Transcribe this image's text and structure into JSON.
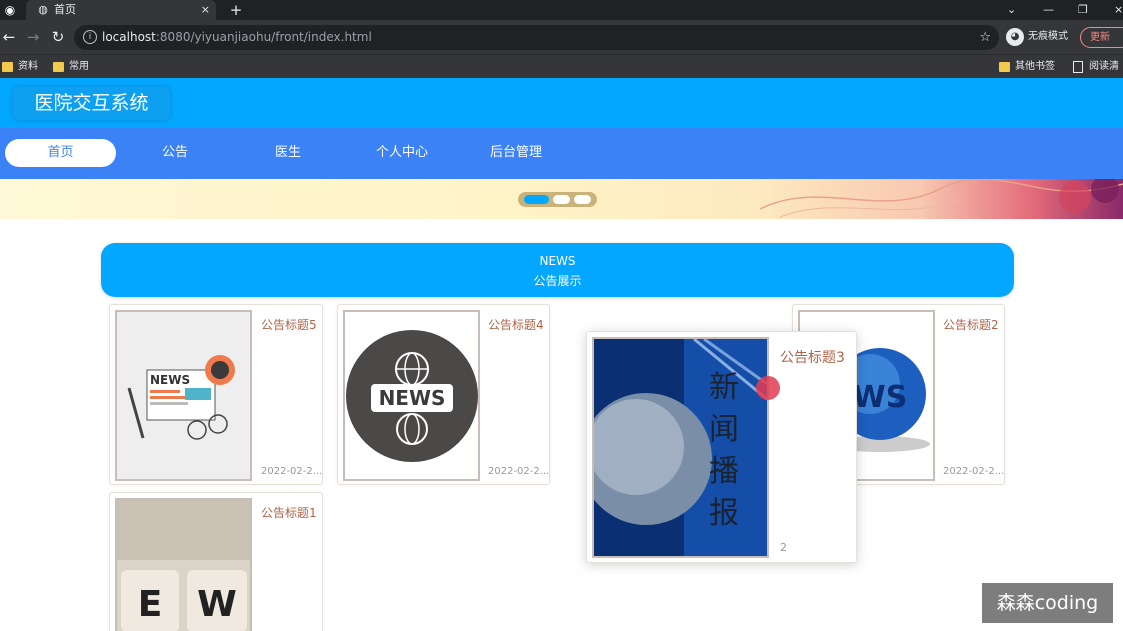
{
  "browser": {
    "tab_title": "首页",
    "tab_close": "×",
    "new_tab": "+",
    "url_host": "localhost",
    "url_rest": ":8080/yiyuanjiaohu/front/index.html",
    "incognito_label": "无痕模式",
    "update_label": "更新",
    "bookmarks": [
      "资料",
      "常用"
    ],
    "bookmarks_right": [
      "其他书签",
      "阅读清单"
    ]
  },
  "site": {
    "logo": "医院交互系统",
    "nav": [
      "首页",
      "公告",
      "医生",
      "个人中心",
      "后台管理"
    ],
    "active_nav": 0
  },
  "banner": {
    "slides": 3,
    "active_slide": 0
  },
  "news": {
    "heading_en": "NEWS",
    "heading_cn": "公告展示",
    "items": [
      {
        "title": "公告标题5",
        "date": "2022-02-2..."
      },
      {
        "title": "公告标题4",
        "date": "2022-02-2..."
      },
      {
        "title": "公告标题3",
        "date": "2"
      },
      {
        "title": "公告标题2",
        "date": "2022-02-2..."
      },
      {
        "title": "公告标题1",
        "date": ""
      }
    ],
    "image_texts": {
      "news_word": "NEWS",
      "ew_block_1": "E",
      "ew_block_2": "W"
    }
  },
  "watermark": "森森coding"
}
